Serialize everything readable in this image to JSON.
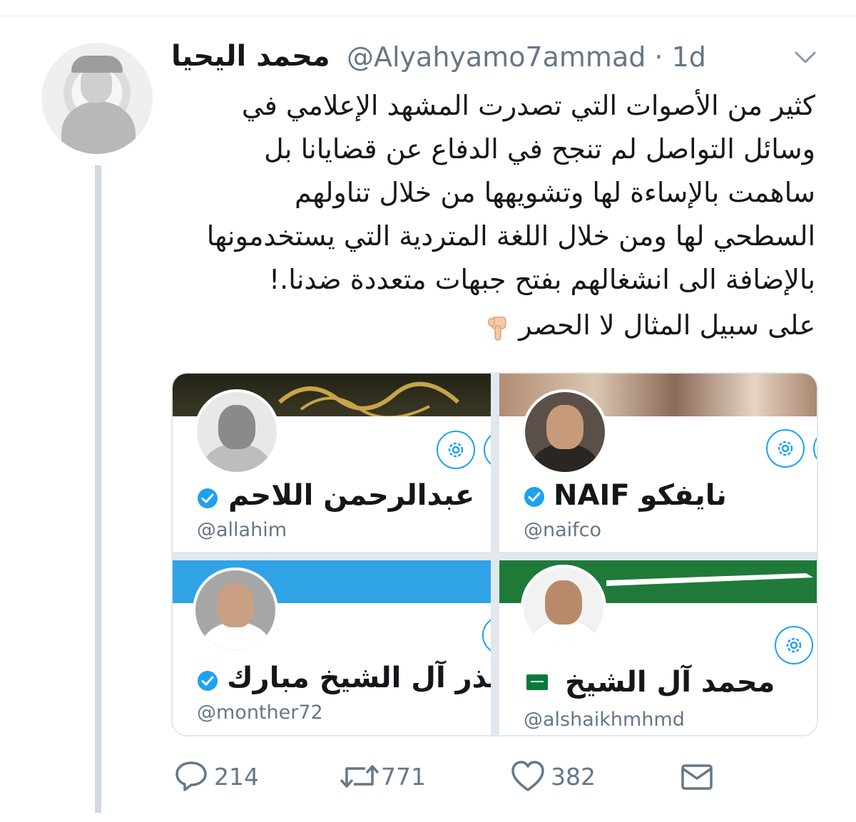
{
  "tweet": {
    "author": {
      "display_name": "محمد اليحيا",
      "handle_time": "@Alyahyamo7ammad · 1d"
    },
    "text_lines": [
      "كثير من الأصوات التي  تصدرت المشهد الإعلامي في",
      "وسائل التواصل لم تنجح في الدفاع عن قضايانا بل",
      "ساهمت بالإساءة لها وتشويهها من خلال تناولهم",
      "السطحي لها ومن خلال اللغة المتردية التي يستخدمونها",
      "بالإضافة الى انشغالهم بفتح جبهات متعددة ضدنا.!"
    ],
    "sub_line": "على سبيل المثال لا الحصر",
    "pointing_emoji": "pointing-down-icon"
  },
  "cards": [
    {
      "name": "نايفكو NAIF",
      "handle": "@naifco",
      "badge": "verified-badge-icon",
      "banner_color": "#c8b39c"
    },
    {
      "name": "عبدالرحمن اللاحم",
      "handle": "@allahim",
      "badge": "verified-badge-icon",
      "banner_color": "#2a2a1e"
    },
    {
      "name": "محمد آل الشيخ",
      "handle": "@alshaikhmhmd",
      "badge": "flag-icon",
      "banner_color": "#1f7a3a"
    },
    {
      "name": "منذر آل الشيخ مبارك",
      "handle": "@monther72",
      "badge": "verified-badge-icon",
      "banner_color": "#2fa3e6"
    }
  ],
  "actions": {
    "reply_count": "214",
    "retweet_count": "771",
    "like_count": "382"
  },
  "colors": {
    "accent": "#1da1f2",
    "muted": "#657786",
    "border": "#e1e8ed"
  }
}
